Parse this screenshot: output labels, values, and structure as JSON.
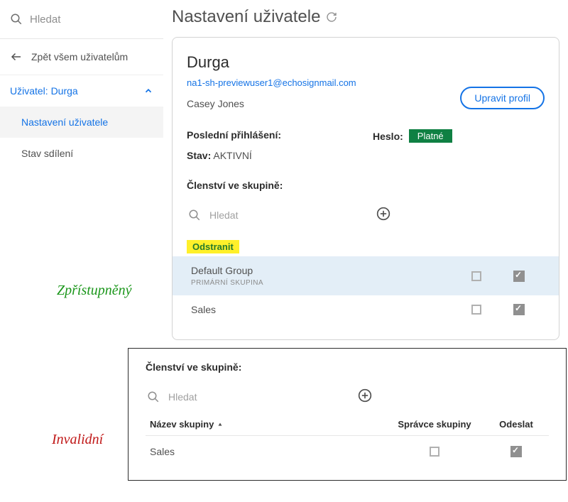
{
  "sidebar": {
    "search_placeholder": "Hledat",
    "back_label": "Zpět všem uživatelům",
    "nav_header": "Uživatel: Durga",
    "items": [
      {
        "label": "Nastavení uživatele"
      },
      {
        "label": "Stav sdílení"
      }
    ]
  },
  "page": {
    "title": "Nastavení uživatele"
  },
  "user": {
    "name": "Durga",
    "email": "na1-sh-previewuser1@echosignmail.com",
    "company": "Casey Jones",
    "edit_button": "Upravit profil",
    "last_login_label": "Poslední přihlášení:",
    "last_login_value": "",
    "password_label": "Heslo:",
    "password_badge": "Platné",
    "state_label": "Stav:",
    "state_value": "AKTIVNÍ"
  },
  "groups_enabled": {
    "title": "Členství ve skupině:",
    "search_placeholder": "Hledat",
    "remove_label": "Odstranit",
    "rows": [
      {
        "name": "Default Group",
        "primary": "PRIMÁRNÍ SKUPINA"
      },
      {
        "name": "Sales"
      }
    ]
  },
  "groups_disabled": {
    "title": "Členství ve skupině:",
    "search_placeholder": "Hledat",
    "col_name": "Název skupiny",
    "col_admin": "Správce skupiny",
    "col_send": "Odeslat",
    "rows": [
      {
        "name": "Sales"
      }
    ]
  },
  "annotations": {
    "enabled": "Zpřístupněný",
    "disabled": "Invalidní"
  }
}
